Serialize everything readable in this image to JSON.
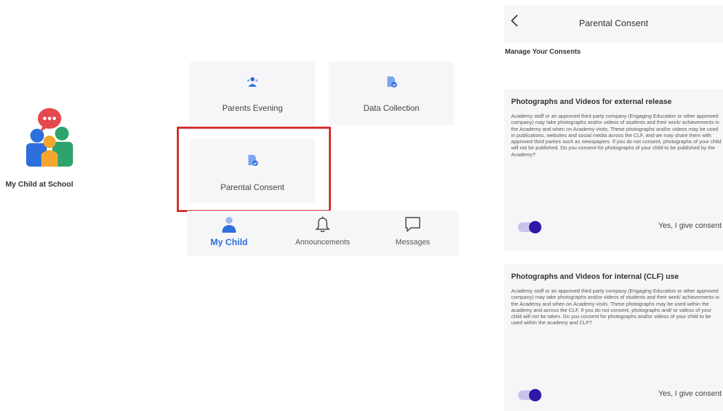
{
  "colors": {
    "accent": "#2f6fdc",
    "toggle_on": "#3018a8",
    "highlight": "#d62c2c",
    "card_bg": "#f6f6f8"
  },
  "left_app": {
    "label": "My Child at School",
    "icon": "family-chat-icon"
  },
  "tiles": [
    {
      "label": "Parents Evening",
      "icon": "meeting-icon"
    },
    {
      "label": "Data Collection",
      "icon": "document-check-icon"
    },
    {
      "label": "Parental Consent",
      "icon": "document-check-icon"
    }
  ],
  "bottom_nav": [
    {
      "label": "My Child",
      "icon": "person-icon",
      "active": true
    },
    {
      "label": "Announcements",
      "icon": "bell-icon",
      "active": false
    },
    {
      "label": "Messages",
      "icon": "chat-bubble-icon",
      "active": false
    }
  ],
  "phone": {
    "header_title": "Parental Consent",
    "back_icon": "chevron-left-icon",
    "manage_title": "Manage Your Consents",
    "cards": [
      {
        "title": "Photographs and Videos for external release",
        "body": "Academy staff or an approved third party company (Engaging Education or other approved company) may take photographs and/or videos of students and their work/ achievements in the Academy and when on Academy visits. These photographs and/or videos may be used in publications, websites and social media across the CLF, and we may share them with approved third parties such as newspapers. If you do not consent, photographs of your child will not be published. Do you consent for photographs of your child to be published by the Academy?",
        "toggle_on": true,
        "consent_label": "Yes, I give consent"
      },
      {
        "title": "Photographs and Videos for internal (CLF) use",
        "body": "Academy staff or an approved third party company (Engaging Education or other approved company) may take photographs and/or videos of students and their work/ achievements in the Academy and when on Academy visits. These photographs may be used within the academy and across the CLF. If you do not consent, photographs and/ or videos of your child will not be taken. Do you consent for photographs and/or videos of your child to be used within the academy and CLF?",
        "toggle_on": true,
        "consent_label": "Yes, I give consent"
      }
    ]
  }
}
